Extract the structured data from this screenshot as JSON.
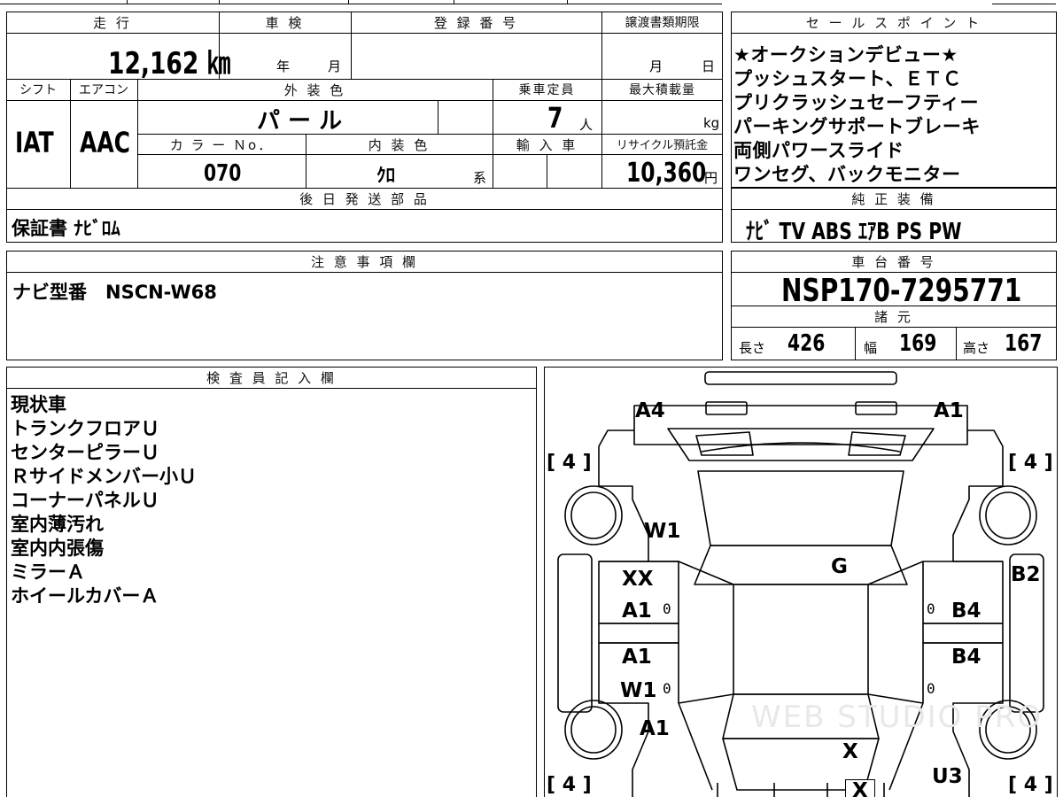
{
  "top_grid": {
    "headers": {
      "mileage": "走 行",
      "inspection": "車 検",
      "registration": "登 録 番 号",
      "transfer_deadline": "譲渡書類期限"
    },
    "mileage_value": "12,162 ㎞",
    "inspection_year": "年",
    "inspection_month": "月",
    "deadline_month": "月",
    "deadline_day": "日",
    "headers2": {
      "shift": "シフト",
      "aircon": "エアコン",
      "exterior_color": "外 装 色",
      "capacity": "乗車定員",
      "max_load": "最大積載量"
    },
    "shift_value": "IAT",
    "aircon_value": "AAC",
    "exterior_color_value": "パ ー ル",
    "capacity_value": "7",
    "capacity_unit": "人",
    "max_load_unit": "kg",
    "headers3": {
      "color_no": "カ ラ ー Ｎo．",
      "interior_color": "内 装 色",
      "import": "輸 入 車",
      "recycle": "リサイクル預託金"
    },
    "color_no_value": "070",
    "interior_color_value": "ｸﾛ",
    "interior_suffix": "系",
    "recycle_value": "10,360",
    "recycle_unit": "円",
    "later_parts_header": "後 日 発 送 部 品",
    "later_parts_value": "保証書 ﾅﾋﾞﾛﾑ"
  },
  "sales_points": {
    "header": "セ ー ル ス ポ イ ン ト",
    "lines": [
      "★オークションデビュー★",
      "プッシュスタート、ＥＴＣ",
      "プリクラッシュセーフティー",
      "パーキングサポートブレーキ",
      "両側パワースライド",
      "ワンセグ、バックモニター"
    ]
  },
  "equipment": {
    "header": "純 正 装 備",
    "value": "ﾅﾋﾞ  TV  ABS  ｴｱB  PS  PW"
  },
  "notes": {
    "header": "注 意 事 項 欄",
    "value": "ナビ型番　NSCN-W68"
  },
  "chassis": {
    "header": "車 台 番 号",
    "value": "NSP170-7295771"
  },
  "specs": {
    "header": "諸 元",
    "length_label": "長さ",
    "length_value": "426",
    "width_label": "幅",
    "width_value": "169",
    "height_label": "高さ",
    "height_value": "167"
  },
  "inspector": {
    "header": "検 査 員 記 入 欄",
    "lines": [
      "現状車",
      "トランクフロアＵ",
      "センターピラーＵ",
      "Ｒサイドメンバー小Ｕ",
      "コーナーパネルＵ",
      "室内薄汚れ",
      "室内内張傷",
      "ミラーＡ",
      "ホイールカバーＡ"
    ]
  },
  "diagram": {
    "marks": {
      "rear_left": "A4",
      "rear_right": "A1",
      "tire_tl": "[ 4 ]",
      "tire_tr": "[ 4 ]",
      "tire_bl": "[ 4 ]",
      "tire_br": "[ 4 ]",
      "rear_window": "W1",
      "roof": "G",
      "right_quarter": "B2",
      "left_rear_door_a": "XX",
      "left_rear_door_b": "A1",
      "right_rear_door": "B4",
      "left_front_door_a": "A1",
      "left_front_door_b": "W1",
      "right_front_door": "B4",
      "left_front_fender": "A1",
      "hood": "X",
      "right_front_fender": "U3",
      "front_bumper": "X"
    },
    "zero": "0",
    "watermark": "WEB STUDIO PRO"
  }
}
